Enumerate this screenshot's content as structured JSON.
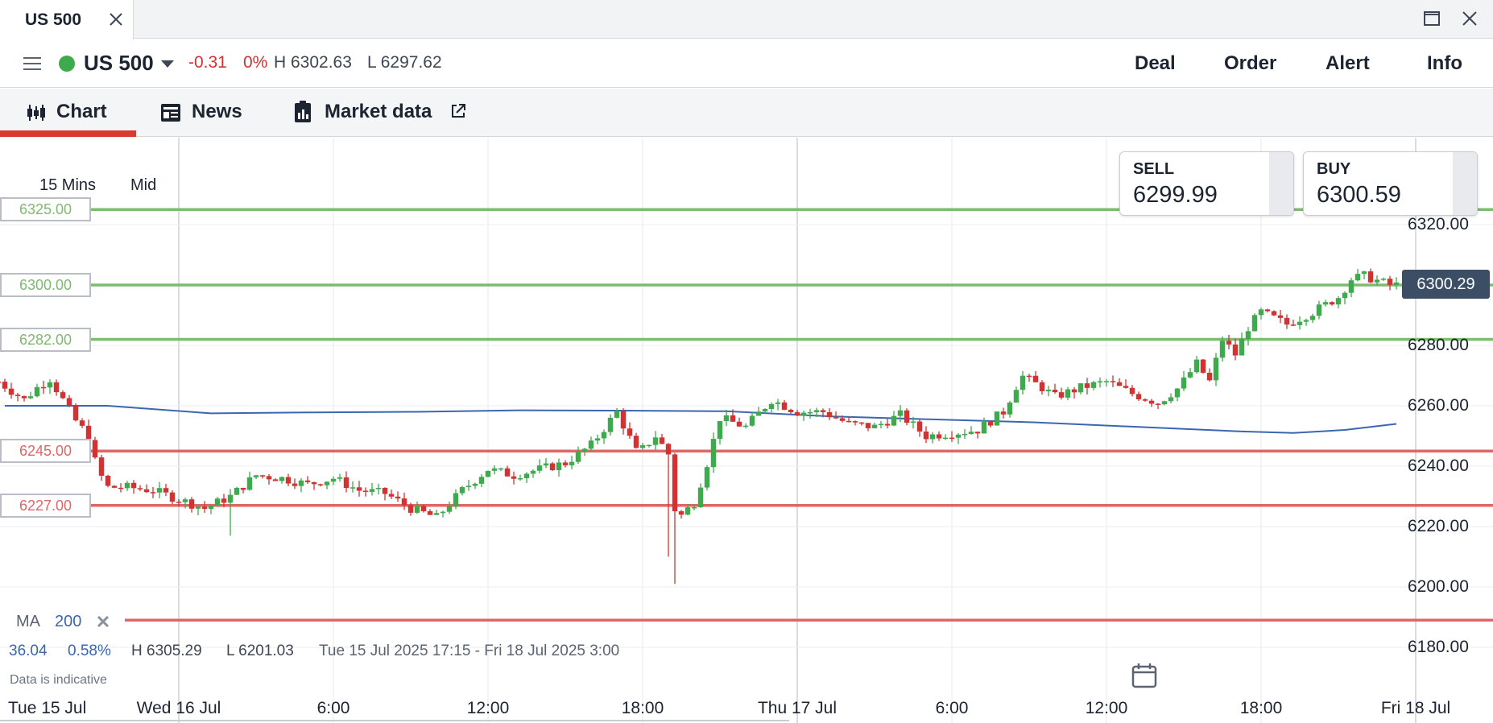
{
  "window": {
    "tab_title": "US 500",
    "icons": {
      "close": "close-icon",
      "maximize": "maximize-icon",
      "window_close": "window-close-icon"
    }
  },
  "header": {
    "instrument": "US 500",
    "market_status_color": "#3fa94e",
    "change": "-0.31",
    "change_pct": "0%",
    "high": "H 6302.63",
    "low": "L 6297.62",
    "actions": [
      "Deal",
      "Order",
      "Alert",
      "Info"
    ]
  },
  "view_tabs": [
    {
      "label": "Chart",
      "icon": "candlestick-icon",
      "active": true
    },
    {
      "label": "News",
      "icon": "news-icon",
      "active": false
    },
    {
      "label": "Market data",
      "icon": "market-data-icon",
      "external": true,
      "active": false
    }
  ],
  "chart": {
    "timeframe": "15 Mins",
    "price_type": "Mid",
    "sell_label": "SELL",
    "sell_price": "6299.99",
    "buy_label": "BUY",
    "buy_price": "6300.59",
    "current_price": "6300.29",
    "ma_label": "MA",
    "ma_period": "200",
    "stats": {
      "change": "36.04",
      "change_pct": "0.58%",
      "high": "H 6305.29",
      "low": "L 6201.03",
      "range": "Tue 15 Jul 2025 17:15 - Fri 18 Jul 2025 3:00"
    },
    "disclaimer": "Data is indicative",
    "levels": [
      {
        "label": "6325.00",
        "value": 6325,
        "color": "#7dbb6e"
      },
      {
        "label": "6300.00",
        "value": 6300,
        "color": "#7dbb6e"
      },
      {
        "label": "6282.00",
        "value": 6282,
        "color": "#7dbb6e"
      },
      {
        "label": "6245.00",
        "value": 6245,
        "color": "#e06666"
      },
      {
        "label": "6227.00",
        "value": 6227,
        "color": "#e06666"
      },
      {
        "label": "",
        "value": 6189,
        "color": "#e06666"
      }
    ]
  },
  "chart_data": {
    "type": "candlestick",
    "title": "",
    "y_ticks": [
      "6320.00",
      "6280.00",
      "6260.00",
      "6240.00",
      "6220.00",
      "6200.00",
      "6180.00"
    ],
    "y_tick_values": [
      6320,
      6280,
      6260,
      6240,
      6220,
      6200,
      6180
    ],
    "x_ticks": [
      "Tue 15 Jul",
      "Wed 16 Jul",
      "6:00",
      "12:00",
      "18:00",
      "Thu 17 Jul",
      "6:00",
      "12:00",
      "18:00",
      "Fri 18 Jul"
    ],
    "x_tick_times": [
      -17.25,
      6.75,
      12.75,
      18.75,
      24.75,
      30.75,
      36.75,
      42.75,
      48.75,
      54.75
    ],
    "ylim": [
      6173,
      6330
    ],
    "time_unit": "hours since Tue 15 Jul 17:15",
    "xlim": [
      -0.25,
      57.3
    ],
    "price_path": [
      [
        0,
        6268
      ],
      [
        1.0,
        6262
      ],
      [
        1.5,
        6266
      ],
      [
        2.0,
        6269
      ],
      [
        2.5,
        6262
      ],
      [
        3.0,
        6255
      ],
      [
        3.5,
        6250
      ],
      [
        3.8,
        6240
      ],
      [
        4.2,
        6233
      ],
      [
        5.0,
        6233
      ],
      [
        6.0,
        6232
      ],
      [
        7.0,
        6229
      ],
      [
        8.0,
        6226
      ],
      [
        9.0,
        6230
      ],
      [
        10.0,
        6237
      ],
      [
        11.0,
        6236
      ],
      [
        12.0,
        6234
      ],
      [
        13.0,
        6236
      ],
      [
        14.0,
        6232
      ],
      [
        15.0,
        6231
      ],
      [
        16.0,
        6226
      ],
      [
        17.0,
        6223
      ],
      [
        18.0,
        6232
      ],
      [
        19.0,
        6239
      ],
      [
        20.0,
        6237
      ],
      [
        21.0,
        6239
      ],
      [
        22.0,
        6241
      ],
      [
        23.0,
        6247
      ],
      [
        24.0,
        6258
      ],
      [
        24.8,
        6244
      ],
      [
        25.5,
        6250
      ],
      [
        26.0,
        6244
      ],
      [
        26.3,
        6222
      ],
      [
        27.0,
        6228
      ],
      [
        27.5,
        6241
      ],
      [
        28.0,
        6256
      ],
      [
        29.0,
        6253
      ],
      [
        30.0,
        6262
      ],
      [
        31.0,
        6258
      ],
      [
        32.0,
        6258
      ],
      [
        33.0,
        6254
      ],
      [
        34.0,
        6253
      ],
      [
        35.0,
        6257
      ],
      [
        36.0,
        6250
      ],
      [
        37.0,
        6251
      ],
      [
        38.0,
        6252
      ],
      [
        39.0,
        6258
      ],
      [
        39.7,
        6270
      ],
      [
        40.5,
        6266
      ],
      [
        41.0,
        6263
      ],
      [
        42.0,
        6266
      ],
      [
        43.0,
        6268
      ],
      [
        44.0,
        6264
      ],
      [
        45.0,
        6261
      ],
      [
        45.8,
        6266
      ],
      [
        46.5,
        6274
      ],
      [
        47.0,
        6268
      ],
      [
        47.5,
        6282
      ],
      [
        48.0,
        6277
      ],
      [
        48.5,
        6286
      ],
      [
        49.0,
        6291
      ],
      [
        49.5,
        6289
      ],
      [
        50.0,
        6287
      ],
      [
        51.0,
        6291
      ],
      [
        52.0,
        6296
      ],
      [
        52.5,
        6302
      ],
      [
        53.0,
        6303
      ],
      [
        54.0,
        6300
      ]
    ],
    "ma_path": [
      [
        0,
        6260
      ],
      [
        4,
        6260
      ],
      [
        8,
        6257.5
      ],
      [
        12,
        6257.8
      ],
      [
        16,
        6258
      ],
      [
        20,
        6258.5
      ],
      [
        24,
        6258.4
      ],
      [
        28,
        6258.2
      ],
      [
        32,
        6256.5
      ],
      [
        36,
        6255.5
      ],
      [
        40,
        6254.5
      ],
      [
        44,
        6253
      ],
      [
        48,
        6251.5
      ],
      [
        50,
        6251
      ],
      [
        52,
        6252
      ],
      [
        54,
        6254
      ]
    ],
    "ma_color": "#3a67b0",
    "up_color": "#3fa94e",
    "down_color": "#d23232",
    "grid": true
  }
}
